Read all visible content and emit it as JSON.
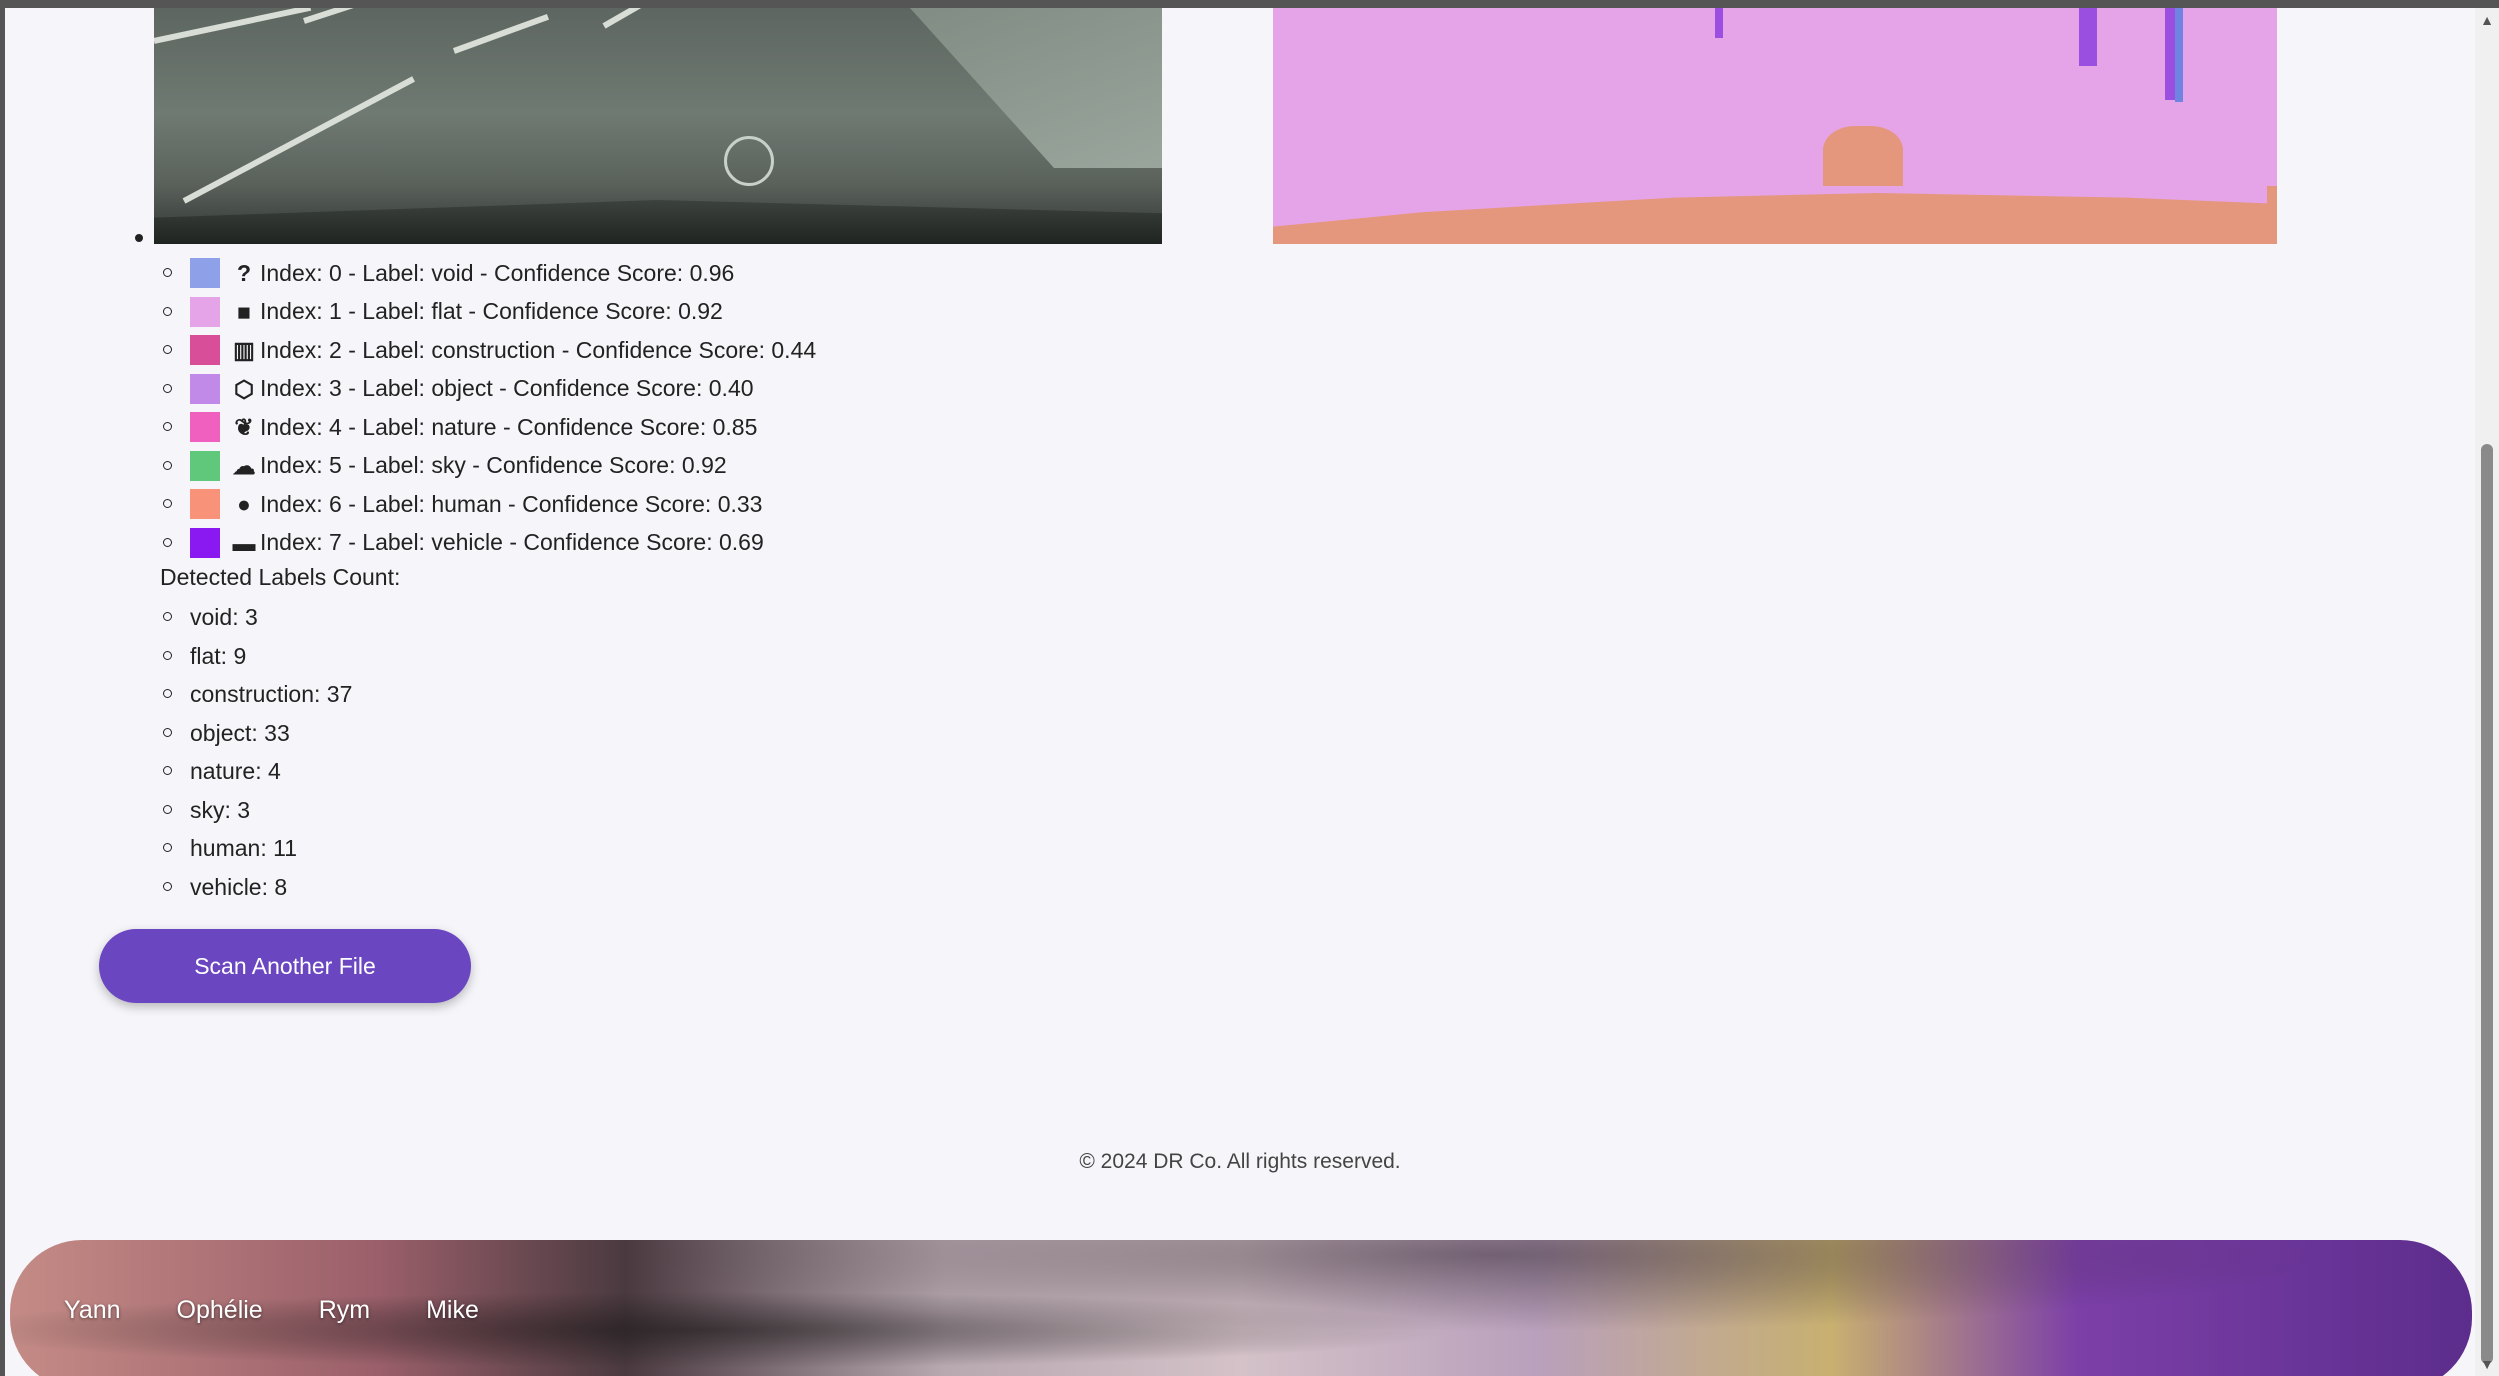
{
  "labels": [
    {
      "color": "#8da0e8",
      "icon": "question-icon",
      "glyph": "?",
      "text": "Index: 0 - Label: void - Confidence Score: 0.96"
    },
    {
      "color": "#e6a4e8",
      "icon": "square-icon",
      "glyph": "■",
      "text": "Index: 1 - Label: flat - Confidence Score: 0.92"
    },
    {
      "color": "#d94e98",
      "icon": "building-icon",
      "glyph": "▥",
      "text": "Index: 2 - Label: construction - Confidence Score: 0.44"
    },
    {
      "color": "#c28ae8",
      "icon": "box-icon",
      "glyph": "⬡",
      "text": "Index: 3 - Label: object - Confidence Score: 0.40"
    },
    {
      "color": "#f060be",
      "icon": "leaf-icon",
      "glyph": "❦",
      "text": "Index: 4 - Label: nature - Confidence Score: 0.85"
    },
    {
      "color": "#5fc87a",
      "icon": "cloud-icon",
      "glyph": "☁",
      "text": "Index: 5 - Label: sky - Confidence Score: 0.92"
    },
    {
      "color": "#f89278",
      "icon": "user-icon",
      "glyph": "●",
      "text": "Index: 6 - Label: human - Confidence Score: 0.33"
    },
    {
      "color": "#8a18f0",
      "icon": "car-icon",
      "glyph": "▬",
      "text": "Index: 7 - Label: vehicle - Confidence Score: 0.69"
    }
  ],
  "counts_title": "Detected Labels Count:",
  "counts": [
    "void: 3",
    "flat: 9",
    "construction: 37",
    "object: 33",
    "nature: 4",
    "sky: 3",
    "human: 11",
    "vehicle: 8"
  ],
  "scan_button_label": "Scan Another File",
  "copyright": "© 2024 DR Co. All rights reserved.",
  "footer_nav": [
    "Yann",
    "Ophélie",
    "Rym",
    "Mike"
  ],
  "colors": {
    "accent": "#6b46c1",
    "page_bg": "#f6f6fa"
  }
}
